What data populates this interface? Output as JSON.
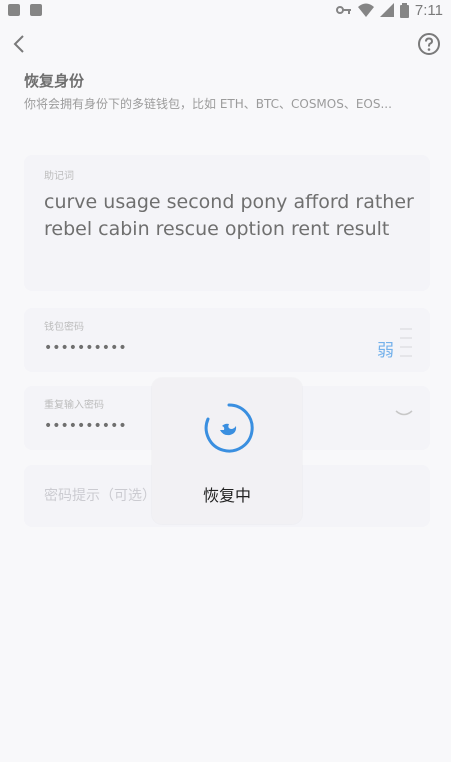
{
  "status_bar": {
    "time": "7:11"
  },
  "header": {
    "title": "恢复身份",
    "subtitle": "你将会拥有身份下的多链钱包，比如 ETH、BTC、COSMOS、EOS..."
  },
  "mnemonic": {
    "label": "助记词",
    "value": "curve usage second pony afford rather rebel cabin rescue option rent result"
  },
  "password": {
    "label": "钱包密码",
    "value": "••••••••••",
    "strength": "弱"
  },
  "repeat_password": {
    "label": "重复输入密码",
    "value": "••••••••••"
  },
  "hint": {
    "placeholder": "密码提示（可选）"
  },
  "loading": {
    "text": "恢复中"
  },
  "colors": {
    "accent": "#2a88e0",
    "card": "#eeeef4"
  }
}
